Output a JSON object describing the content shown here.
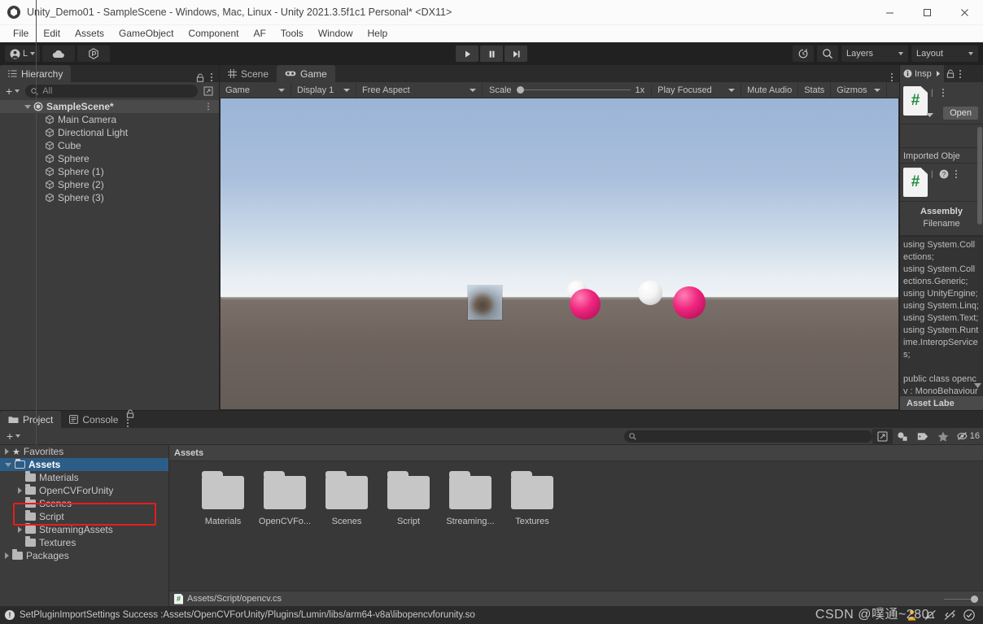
{
  "window": {
    "title": "Unity_Demo01 - SampleScene - Windows, Mac, Linux - Unity 2021.3.5f1c1 Personal* <DX11>",
    "logo_icon": "unity-logo-icon",
    "minimize_icon": "minimize-icon",
    "maximize_icon": "maximize-icon",
    "close_icon": "close-icon"
  },
  "menubar": {
    "items": [
      {
        "label": "File"
      },
      {
        "label": "Edit"
      },
      {
        "label": "Assets"
      },
      {
        "label": "GameObject"
      },
      {
        "label": "Component"
      },
      {
        "label": "AF"
      },
      {
        "label": "Tools"
      },
      {
        "label": "Window"
      },
      {
        "label": "Help"
      }
    ]
  },
  "toolbar": {
    "account_label": "L",
    "cloud_icon": "cloud-icon",
    "collab_icon": "plastic-scm-icon",
    "play_icon": "play-icon",
    "pause_icon": "pause-icon",
    "step_icon": "step-icon",
    "history_icon": "undo-history-icon",
    "search_icon": "search-icon",
    "layers_label": "Layers",
    "layout_label": "Layout"
  },
  "hierarchy": {
    "tab_label": "Hierarchy",
    "tab_icon": "hierarchy-icon",
    "lock_icon": "lock-icon",
    "menu_icon": "kebab-menu-icon",
    "add_label": "+",
    "search_placeholder": "All",
    "search_icon": "search-icon",
    "expand_icon": "expand-window-icon",
    "scene_name": "SampleScene*",
    "scene_icon": "unity-scene-icon",
    "items": [
      {
        "label": "Main Camera",
        "icon": "gameobject-icon"
      },
      {
        "label": "Directional Light",
        "icon": "gameobject-icon"
      },
      {
        "label": "Cube",
        "icon": "gameobject-icon"
      },
      {
        "label": "Sphere",
        "icon": "gameobject-icon"
      },
      {
        "label": "Sphere (1)",
        "icon": "gameobject-icon"
      },
      {
        "label": "Sphere (2)",
        "icon": "gameobject-icon"
      },
      {
        "label": "Sphere (3)",
        "icon": "gameobject-icon"
      }
    ]
  },
  "center": {
    "tabs": [
      {
        "label": "Scene",
        "icon": "scene-grid-icon",
        "active": false
      },
      {
        "label": "Game",
        "icon": "gamepad-icon",
        "active": true
      }
    ],
    "tab_menu_icon": "kebab-menu-icon",
    "game_toolbar": {
      "view_mode": "Game",
      "display": "Display 1",
      "aspect": "Free Aspect",
      "scale_label": "Scale",
      "scale_value": "1x",
      "play_mode": "Play Focused",
      "mute_audio": "Mute Audio",
      "stats": "Stats",
      "gizmos": "Gizmos"
    }
  },
  "inspector": {
    "tab_label": "Insp",
    "tab_icon": "info-icon",
    "next_icon": "arrow-right-icon",
    "lock_icon": "lock-icon",
    "menu_icon": "kebab-menu-icon",
    "script_icon": "csharp-script-icon",
    "script_glyph": "#",
    "open_button": "Open",
    "imported_object_label": "Imported Obje",
    "help_icon": "help-icon",
    "assembly_title": "Assembly",
    "assembly_sub": "Filename",
    "code": "using System.Collections;\nusing System.Collections.Generic;\nusing UnityEngine;\nusing System.Linq;\nusing System.Text;\nusing System.Runtime.InteropServices;\n\npublic class opencv : MonoBehaviour\n{\n  /* private const string DEEP_LEARNING_LIBRARY_",
    "asset_label_bar": "Asset Labe"
  },
  "project": {
    "tabs": [
      {
        "label": "Project",
        "icon": "folder-icon",
        "active": true
      },
      {
        "label": "Console",
        "icon": "console-icon",
        "active": false
      }
    ],
    "lock_icon": "lock-icon",
    "menu_icon": "kebab-menu-icon",
    "add_label": "+",
    "search_placeholder": "",
    "search_icon": "search-icon",
    "toolbar_icons": [
      {
        "name": "open-in-new-window-icon"
      },
      {
        "name": "filter-by-type-icon"
      },
      {
        "name": "filter-by-label-icon"
      },
      {
        "name": "filter-by-favorite-icon"
      }
    ],
    "hidden_count": "16",
    "hidden_count_icon": "hidden-packages-icon",
    "tree": [
      {
        "label": "Favorites",
        "depth": 0,
        "arrow": "right",
        "icon": "star-icon",
        "selected": false
      },
      {
        "label": "Assets",
        "depth": 0,
        "arrow": "down",
        "icon": "folder-open-icon",
        "selected": true
      },
      {
        "label": "Materials",
        "depth": 1,
        "arrow": "none",
        "icon": "folder-icon",
        "selected": false
      },
      {
        "label": "OpenCVForUnity",
        "depth": 1,
        "arrow": "right",
        "icon": "folder-icon",
        "selected": false
      },
      {
        "label": "Scenes",
        "depth": 1,
        "arrow": "none",
        "icon": "folder-icon",
        "selected": false
      },
      {
        "label": "Script",
        "depth": 1,
        "arrow": "none",
        "icon": "folder-icon",
        "selected": false
      },
      {
        "label": "StreamingAssets",
        "depth": 1,
        "arrow": "right",
        "icon": "folder-icon",
        "selected": false
      },
      {
        "label": "Textures",
        "depth": 1,
        "arrow": "none",
        "icon": "folder-icon",
        "selected": false
      },
      {
        "label": "Packages",
        "depth": 0,
        "arrow": "right",
        "icon": "folder-icon",
        "selected": false
      }
    ],
    "breadcrumb": "Assets",
    "grid_items": [
      {
        "label": "Materials",
        "icon": "folder-icon"
      },
      {
        "label": "OpenCVFo...",
        "icon": "folder-icon"
      },
      {
        "label": "Scenes",
        "icon": "folder-icon"
      },
      {
        "label": "Script",
        "icon": "folder-icon"
      },
      {
        "label": "Streaming...",
        "icon": "folder-icon"
      },
      {
        "label": "Textures",
        "icon": "folder-icon"
      }
    ],
    "footer_path": "Assets/Script/opencv.cs",
    "footer_icon": "csharp-script-icon",
    "footer_glyph": "#"
  },
  "statusbar": {
    "icon": "info-exclamation-icon",
    "message": "SetPluginImportSettings Success :Assets/OpenCVForUnity/Plugins/Lumin/libs/arm64-v8a\\libopencvforunity.so",
    "right_icons": [
      {
        "name": "collab-person-icon"
      },
      {
        "name": "no-notification-icon"
      },
      {
        "name": "no-code-optimization-icon"
      },
      {
        "name": "check-circle-icon"
      }
    ]
  },
  "watermark": {
    "text": "CSDN @噗通~280"
  },
  "colors": {
    "accent_selection": "#2c5d87",
    "highlight_box": "#e81c1c",
    "panel_bg": "#3c3c3c",
    "window_bg": "#383838",
    "toolbar_bg": "#212121",
    "sphere_pink": "#f0277f",
    "sphere_white": "#f4f4f4"
  }
}
